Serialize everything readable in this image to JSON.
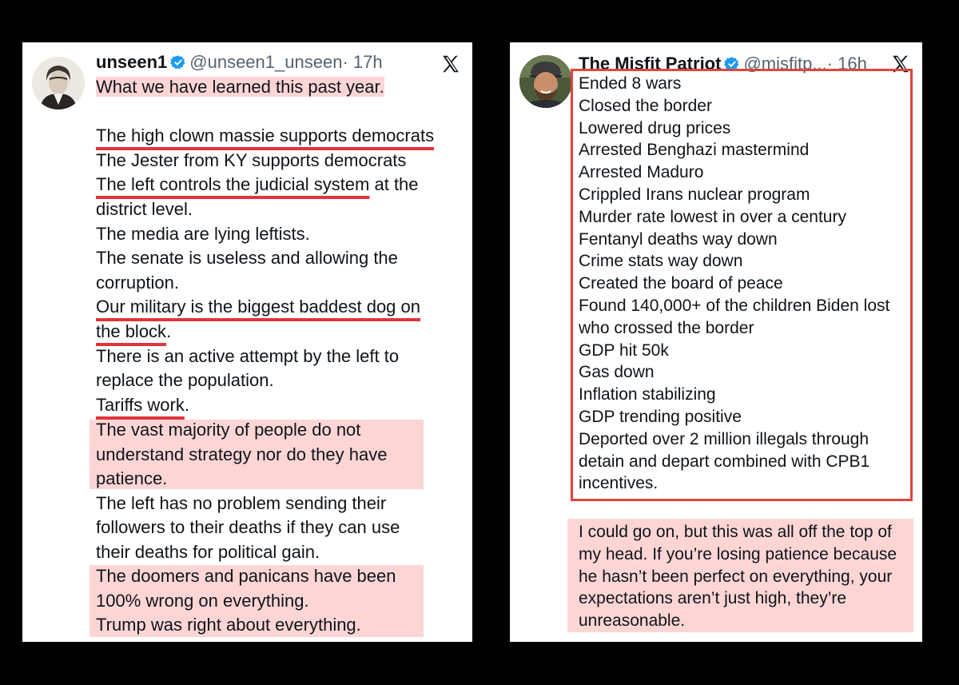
{
  "left_post": {
    "name": "unseen1",
    "handle": "@unseen1_unseen",
    "time": "· 17h",
    "lines": [
      "What we have learned this past year.",
      "",
      "The high clown massie supports democrats",
      "The Jester from KY supports democrats",
      "The left controls the judicial system",
      " at the",
      "district level.",
      "The media are lying leftists.",
      "The senate is useless and allowing the",
      "corruption.",
      "Our military is the biggest baddest dog on",
      "the block",
      ".",
      "There is an active attempt by the left to",
      "replace the population.",
      "Tariffs work",
      ".",
      "The vast majority of people do not",
      "understand strategy nor do they have",
      "patience.",
      "The left has no problem sending their",
      "followers to their deaths if they can use",
      "their deaths for political gain.",
      "The doomers and panicans have been",
      "100% wrong on everything.",
      "Trump was right about everything."
    ]
  },
  "right_post": {
    "name": "The Misfit Patriot",
    "handle": "@misfitp...",
    "time": "· 16h",
    "lines": [
      "Ended 8 wars",
      "Closed the border",
      "Lowered drug prices",
      "Arrested Benghazi mastermind",
      "Arrested Maduro",
      "Crippled Irans nuclear program",
      "Murder rate lowest in over a century",
      "Fentanyl deaths way down",
      "Crime stats way down",
      "Created the board of peace",
      "Found 140,000+ of the children Biden lost",
      "who crossed the border",
      "GDP hit 50k",
      "Gas down",
      "Inflation stabilizing",
      "GDP trending positive",
      "Deported over 2 million illegals through",
      "detain and depart combined with CPB1",
      "incentives."
    ],
    "closing_lines": [
      "I could go on, but this was all off the top of",
      "my head. If you’re losing patience because",
      "he hasn’t been perfect on everything, your",
      "expectations aren’t just high, they’re",
      "unreasonable."
    ]
  },
  "colors": {
    "highlight": "#fdd5d5",
    "underline": "#e0343c",
    "box_border": "#e0443c",
    "verified": "#1d9bf0"
  },
  "icons": [
    "verified-badge-icon",
    "x-logo-icon"
  ]
}
